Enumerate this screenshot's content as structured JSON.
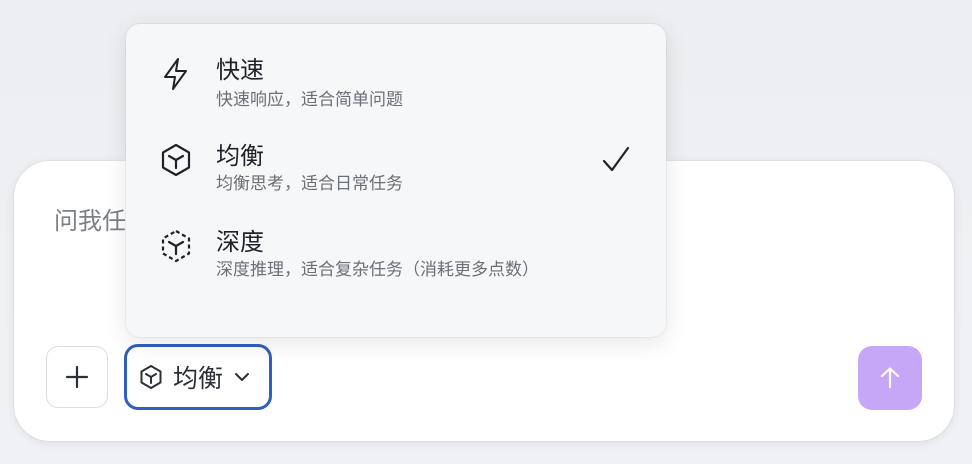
{
  "composer": {
    "placeholder": "问我任何问题",
    "selected_mode_label": "均衡"
  },
  "menu": {
    "items": [
      {
        "title": "快速",
        "desc": "快速响应，适合简单问题",
        "icon": "lightning-icon",
        "selected": false
      },
      {
        "title": "均衡",
        "desc": "均衡思考，适合日常任务",
        "icon": "cube-icon",
        "selected": true
      },
      {
        "title": "深度",
        "desc": "深度推理，适合复杂任务（消耗更多点数）",
        "icon": "dashed-cube-icon",
        "selected": false
      }
    ]
  },
  "colors": {
    "accent_border": "#2f5fbf",
    "send_button": "#c6a6f7",
    "menu_bg": "#f6f7f9"
  }
}
